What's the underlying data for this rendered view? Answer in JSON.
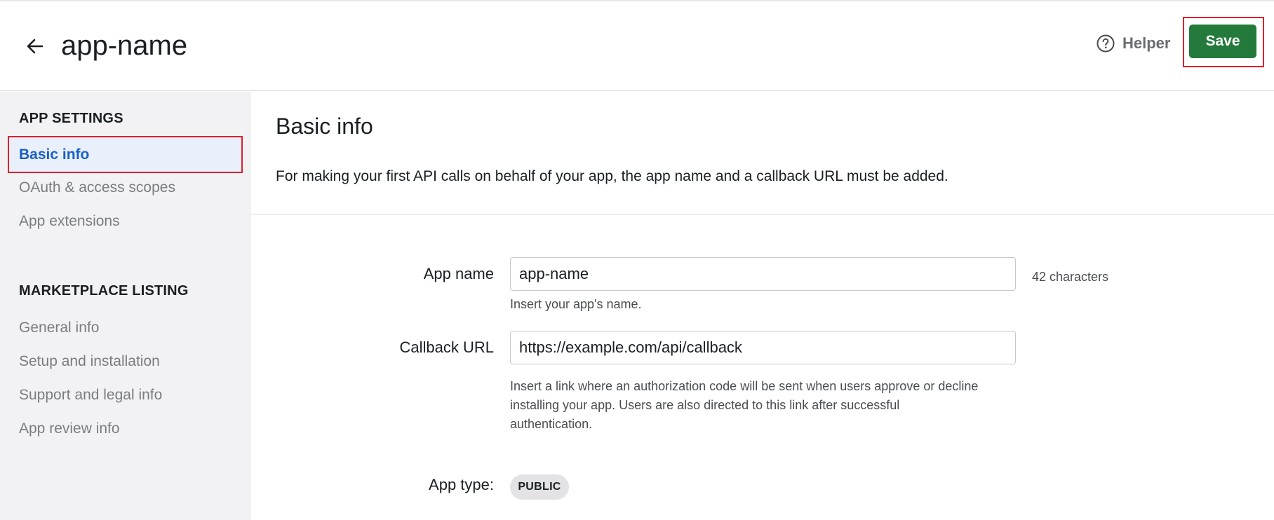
{
  "header": {
    "title": "app-name",
    "back_icon": "arrow-left-icon",
    "helper_icon": "question-circle-icon",
    "helper_label": "Helper",
    "save_label": "Save",
    "save_color": "#237a3a"
  },
  "sidebar": {
    "app_settings_title": "APP SETTINGS",
    "app_settings_items": [
      {
        "label": "Basic info",
        "active": true
      },
      {
        "label": "OAuth & access scopes",
        "active": false
      },
      {
        "label": "App extensions",
        "active": false
      }
    ],
    "marketplace_title": "MARKETPLACE LISTING",
    "marketplace_items": [
      {
        "label": "General info"
      },
      {
        "label": "Setup and installation"
      },
      {
        "label": "Support and legal info"
      },
      {
        "label": "App review info"
      }
    ],
    "active_color": "#1a5fc4"
  },
  "main": {
    "title": "Basic info",
    "description": "For making your first API calls on behalf of your app, the app name and a callback URL must be added.",
    "form": {
      "app_name": {
        "label": "App name",
        "value": "app-name",
        "hint": "Insert your app's name.",
        "char_count": "42 characters"
      },
      "callback_url": {
        "label": "Callback URL",
        "value": "https://example.com/api/callback",
        "hint_lines": [
          "Insert a link where an authorization code will be sent when users approve or decline",
          "installing your app. Users are also directed to this link after successful",
          "authentication."
        ]
      },
      "app_type": {
        "label": "App type:",
        "badge": "PUBLIC"
      }
    }
  }
}
